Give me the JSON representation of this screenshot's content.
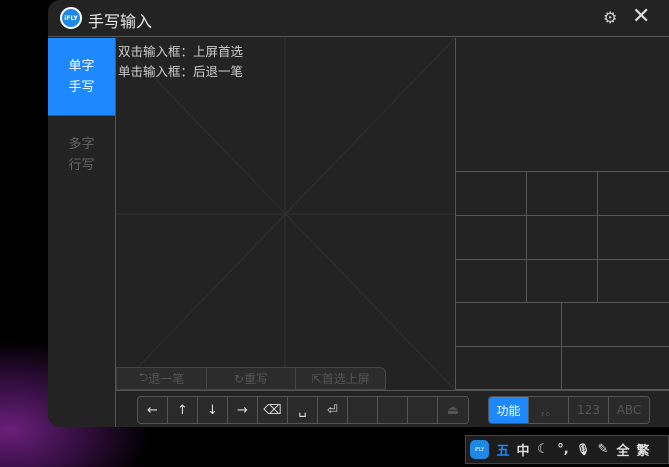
{
  "title": "手写输入",
  "logo_text": "iFLY",
  "tabs": [
    {
      "line1": "单字",
      "line2": "手写"
    },
    {
      "line1": "多字",
      "line2": "行写"
    }
  ],
  "hints": [
    "双击输入框：上屏首选",
    "单击输入框：后退一笔"
  ],
  "actions": [
    {
      "icon": "⮌",
      "label": "退一笔"
    },
    {
      "icon": "↻",
      "label": "重写"
    },
    {
      "icon": "⇱",
      "label": "首选上屏"
    }
  ],
  "keys": [
    "←",
    "↑",
    "↓",
    "→",
    "⌫",
    "␣",
    "⏎",
    "",
    "",
    "",
    "⏏"
  ],
  "mode_keys": [
    "功能",
    "，。",
    "123",
    "ABC"
  ],
  "tray": {
    "logo": "iFLY",
    "items": [
      "五",
      "中",
      "☾",
      "°,",
      "🎙",
      "✎",
      "全",
      "繁"
    ],
    "accent": "#1e88ff"
  }
}
